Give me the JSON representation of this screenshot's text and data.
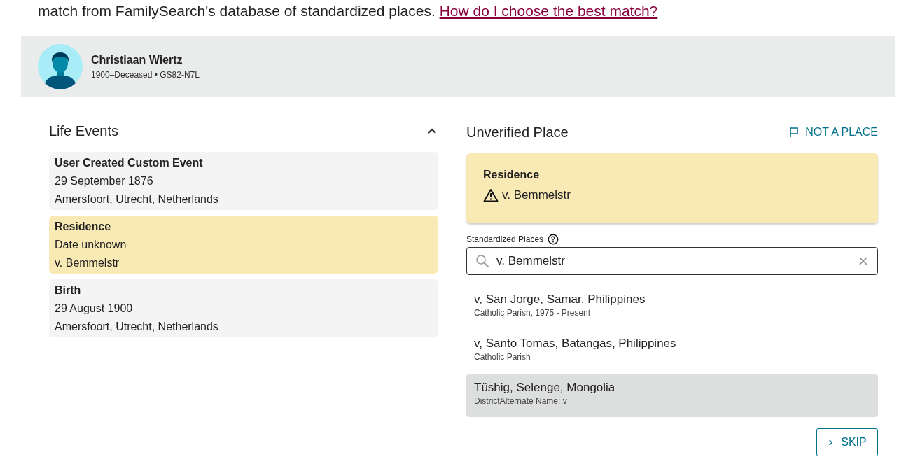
{
  "intro": {
    "text": "match from FamilySearch's database of standardized places.",
    "link": "How do I choose the best match?"
  },
  "person": {
    "name": "Christiaan Wiertz",
    "details": "1900–Deceased • GS82-N7L"
  },
  "life_events": {
    "title": "Life Events",
    "expanded": true,
    "items": [
      {
        "title": "User Created Custom Event",
        "date": "29 September 1876",
        "place": "Amersfoort, Utrecht, Netherlands",
        "selected": false
      },
      {
        "title": "Residence",
        "date": "Date unknown",
        "place": "v. Bemmelstr",
        "selected": true
      },
      {
        "title": "Birth",
        "date": "29 August 1900",
        "place": "Amersfoort, Utrecht, Netherlands",
        "selected": false
      }
    ]
  },
  "unverified": {
    "title": "Unverified Place",
    "not_a_place": "NOT A PLACE",
    "event": "Residence",
    "place": "v. Bemmelstr"
  },
  "search": {
    "label": "Standardized Places",
    "value": "v. Bemmelstr"
  },
  "results": [
    {
      "name": "v, San Jorge, Samar, Philippines",
      "detail": "Catholic Parish, 1975 - Present",
      "selected": false
    },
    {
      "name": "v, Santo Tomas, Batangas, Philippines",
      "detail": "Catholic Parish",
      "selected": false
    },
    {
      "name": "Tüshig, Selenge, Mongolia",
      "detail": "DistrictAlternate Name: v",
      "selected": true
    }
  ],
  "skip": "SKIP"
}
